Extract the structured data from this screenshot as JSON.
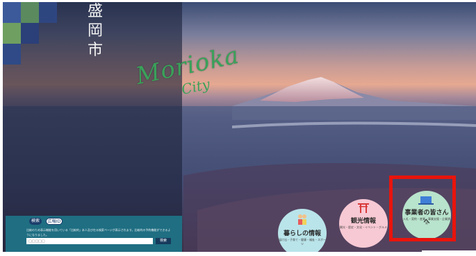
{
  "city_name_kanji": [
    "盛",
    "岡",
    "市"
  ],
  "logo": {
    "main": "Morioka",
    "sub": "City"
  },
  "search": {
    "tabs": [
      "検索",
      "広報ID"
    ],
    "notice": "比較のため表示機能を用いている「比較的」本人及び在る検索ページが表示されます。比較的の予約機能ができるようになりました。",
    "placeholder": "□□□□□",
    "button_label": "検索"
  },
  "circles": [
    {
      "title": "暮らしの情報",
      "sub": "届け出・子育て・健康・福祉・スポーツ",
      "color": "#b9e4ea"
    },
    {
      "title": "観光情報",
      "sub": "観光・歴史・文化・イベント・グルメ",
      "color": "#f7c9d4"
    },
    {
      "title": "事業者の皆さんへ",
      "sub": "入札・契約・産業・事業支援・企業誘致",
      "color": "#b8e3cc"
    }
  ],
  "highlight_color": "#e8140c"
}
